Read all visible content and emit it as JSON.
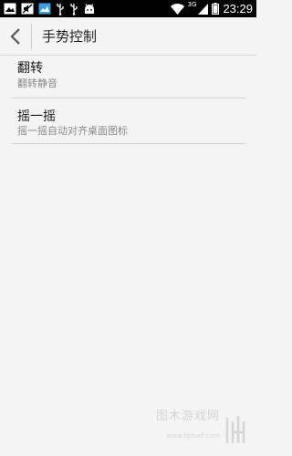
{
  "status_bar": {
    "network_type": "3G",
    "time": "23:29",
    "icons": [
      "image-icon",
      "mute-icon",
      "gallery-icon",
      "usb-icon",
      "usb-icon",
      "android-icon",
      "wifi-icon",
      "signal-icon",
      "battery-icon"
    ]
  },
  "action_bar": {
    "title": "手势控制",
    "back_icon": "chevron-left-icon"
  },
  "settings": [
    {
      "title": "翻转",
      "subtitle": "翻转静音"
    },
    {
      "title": "摇一摇",
      "subtitle": "摇一摇自动对齐桌面图标"
    }
  ],
  "watermark": {
    "text": "图木游戏网",
    "url": "www.tiptudi.com"
  },
  "colors": {
    "background": "#f4f4f4",
    "status_bar": "#000000",
    "divider": "#d2d2d2",
    "title_text": "#1a1a1a",
    "subtitle_text": "#8a8a8a"
  }
}
